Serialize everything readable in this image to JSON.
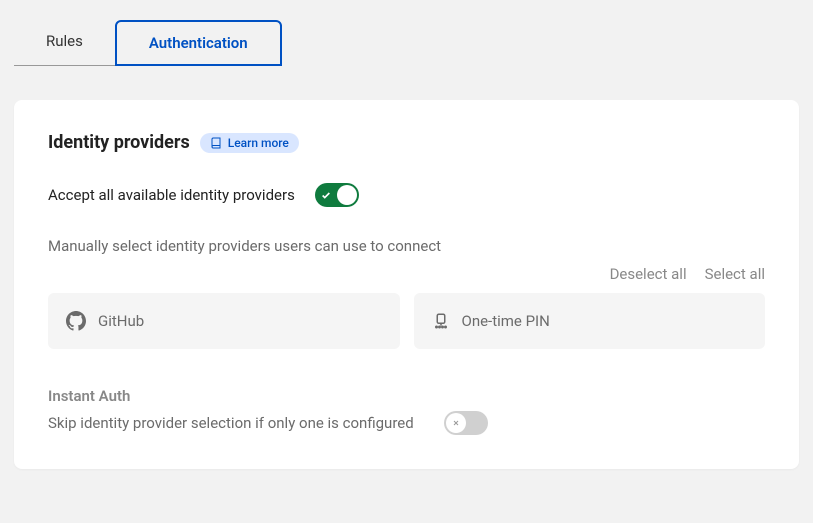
{
  "tabs": {
    "rules": "Rules",
    "authentication": "Authentication"
  },
  "panel": {
    "title": "Identity providers",
    "learn_more": "Learn more"
  },
  "accept": {
    "label": "Accept all available identity providers",
    "enabled": true
  },
  "manual": {
    "label": "Manually select identity providers users can use to connect",
    "deselect_all": "Deselect all",
    "select_all": "Select all"
  },
  "providers": [
    {
      "name": "GitHub",
      "icon": "github"
    },
    {
      "name": "One-time PIN",
      "icon": "pin"
    }
  ],
  "instant": {
    "title": "Instant Auth",
    "label": "Skip identity provider selection if only one is configured",
    "enabled": false
  }
}
